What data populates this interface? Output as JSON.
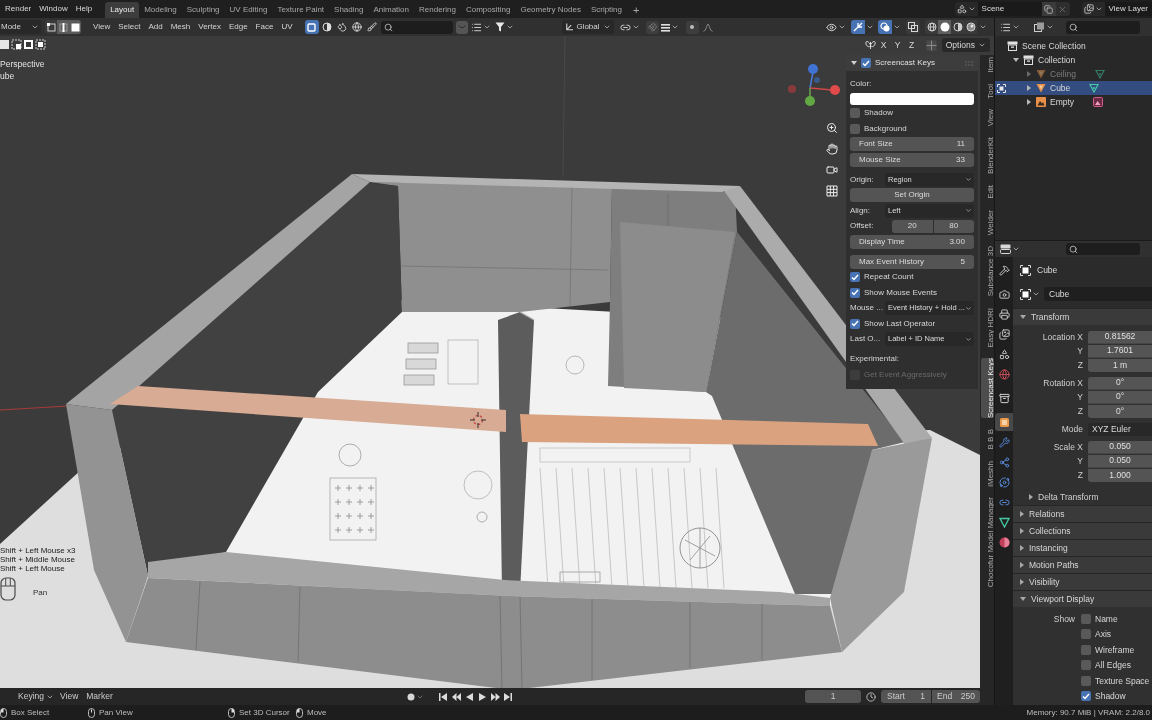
{
  "top_bar": {
    "menus": [
      "Render",
      "Window",
      "Help"
    ],
    "workspaces": [
      {
        "label": "Layout",
        "selected": true
      },
      {
        "label": "Modeling",
        "selected": false
      },
      {
        "label": "Sculpting",
        "selected": false
      },
      {
        "label": "UV Editing",
        "selected": false
      },
      {
        "label": "Texture Paint",
        "selected": false
      },
      {
        "label": "Shading",
        "selected": false
      },
      {
        "label": "Animation",
        "selected": false
      },
      {
        "label": "Rendering",
        "selected": false
      },
      {
        "label": "Compositing",
        "selected": false
      },
      {
        "label": "Geometry Nodes",
        "selected": false
      },
      {
        "label": "Scripting",
        "selected": false
      }
    ],
    "add_tab": "+",
    "scene": "Scene",
    "view_layer": "View Layer"
  },
  "viewport_header": {
    "mode": "Mode",
    "select_modes": [
      {
        "kind": "vertex",
        "selected": false
      },
      {
        "kind": "edge",
        "selected": true
      },
      {
        "kind": "face",
        "selected": true
      }
    ],
    "menus": [
      "View",
      "Select",
      "Add",
      "Mesh",
      "Vertex",
      "Edge",
      "Face",
      "UV"
    ],
    "toggles": [
      {
        "kind": "square",
        "on": true
      },
      {
        "kind": "half_sphere",
        "on": false
      },
      {
        "kind": "droplets",
        "on": false
      },
      {
        "kind": "globe",
        "on": false
      },
      {
        "kind": "brush",
        "on": false
      }
    ],
    "orientation": "Global",
    "gizmos_on": true,
    "overlays_on": true,
    "xray_on": false,
    "shading": [
      {
        "kind": "wireframe",
        "selected": false
      },
      {
        "kind": "solid",
        "selected": true
      },
      {
        "kind": "material",
        "selected": false
      },
      {
        "kind": "rendered",
        "selected": false
      }
    ],
    "mirror": [
      {
        "label": "X",
        "on": false
      },
      {
        "label": "Y",
        "on": false
      },
      {
        "label": "Z",
        "on": false
      }
    ],
    "options": "Options"
  },
  "viewport": {
    "view_name": "Perspective",
    "object_name": "ube",
    "key_log": [
      "Shift + Left Mouse x3",
      "Shift + Middle Mouse",
      "Shift + Left Mouse"
    ],
    "key_hint": "Pan"
  },
  "sidebar": {
    "panel": {
      "title": "Screencast Keys",
      "expanded": true,
      "enabled": true,
      "sections": [
        {
          "rows": [
            {
              "kind": "label",
              "text": "Color:"
            },
            {
              "kind": "color",
              "color": "#ffffff"
            },
            {
              "kind": "checkbox",
              "label": "Shadow",
              "checked": false,
              "disabled": false
            },
            {
              "kind": "checkbox",
              "label": "Background",
              "checked": false,
              "disabled": false
            },
            {
              "kind": "number",
              "label": "Font Size",
              "value": "11"
            },
            {
              "kind": "number",
              "label": "Mouse Size",
              "value": "33"
            }
          ]
        },
        {
          "rows": [
            {
              "kind": "dropdown",
              "label": "Origin:",
              "value": "Region"
            },
            {
              "kind": "button",
              "label": "Set Origin"
            },
            {
              "kind": "dropdown",
              "label": "Align:",
              "value": "Left"
            },
            {
              "kind": "pair",
              "label": "Offset:",
              "values": [
                "20",
                "80"
              ]
            },
            {
              "kind": "number",
              "label": "Display Time",
              "value": "3.00"
            }
          ]
        },
        {
          "rows": [
            {
              "kind": "number",
              "label": "Max Event History",
              "value": "5"
            },
            {
              "kind": "checkbox",
              "label": "Repeat Count",
              "checked": true,
              "disabled": false
            },
            {
              "kind": "checkbox",
              "label": "Show Mouse Events",
              "checked": true,
              "disabled": false
            },
            {
              "kind": "dropdown",
              "label": "Mouse ...",
              "value": "Event History + Hold ..."
            },
            {
              "kind": "checkbox",
              "label": "Show Last Operator",
              "checked": true,
              "disabled": false
            },
            {
              "kind": "dropdown",
              "label": "Last O...",
              "value": "Label + ID Name"
            }
          ]
        },
        {
          "rows": [
            {
              "kind": "label",
              "text": "Experimental:"
            },
            {
              "kind": "checkbox",
              "label": "Get Event Aggressively",
              "checked": false,
              "disabled": true
            }
          ]
        }
      ]
    },
    "tabs": [
      {
        "label": "Item",
        "selected": false
      },
      {
        "label": "Tool",
        "selected": false
      },
      {
        "label": "View",
        "selected": false
      },
      {
        "label": "BlenderKit",
        "selected": false
      },
      {
        "label": "Edit",
        "selected": false
      },
      {
        "label": "Welder",
        "selected": false
      },
      {
        "label": "Substance 3D",
        "selected": false
      },
      {
        "label": "Easy HDRI",
        "selected": false
      },
      {
        "label": "Screencast Keys",
        "selected": true
      },
      {
        "label": "B B B",
        "selected": false
      },
      {
        "label": "iMeshh",
        "selected": false
      },
      {
        "label": "Chocofur Model Manager",
        "selected": false
      }
    ]
  },
  "outliner": {
    "tree": [
      {
        "label": "Scene Collection",
        "kind": "scene_collection",
        "selected": false,
        "children": [
          {
            "label": "Collection",
            "kind": "collection",
            "expanded": true,
            "selected": false,
            "children": [
              {
                "label": "Ceiling",
                "kind": "mesh",
                "expanded": false,
                "selected": false,
                "hidden": true
              },
              {
                "label": "Cube",
                "kind": "mesh",
                "expanded": false,
                "selected": true,
                "hidden": false
              },
              {
                "label": "Empty",
                "kind": "image_empty",
                "expanded": false,
                "selected": false,
                "hidden": false
              }
            ]
          }
        ]
      }
    ]
  },
  "properties": {
    "tab_groups": [
      {
        "tabs": [
          {
            "kind": "tool",
            "selected": false
          }
        ]
      },
      {
        "tabs": [
          {
            "kind": "render",
            "selected": false
          },
          {
            "kind": "output",
            "selected": false
          },
          {
            "kind": "view_layer",
            "selected": false
          },
          {
            "kind": "scene",
            "selected": false
          },
          {
            "kind": "world",
            "selected": false
          }
        ]
      },
      {
        "tabs": [
          {
            "kind": "collection",
            "selected": false
          }
        ]
      },
      {
        "tabs": [
          {
            "kind": "object",
            "selected": true
          },
          {
            "kind": "modifiers",
            "selected": false
          },
          {
            "kind": "particles",
            "selected": false
          },
          {
            "kind": "physics",
            "selected": false
          },
          {
            "kind": "constraints",
            "selected": false
          },
          {
            "kind": "data",
            "selected": false
          },
          {
            "kind": "material",
            "selected": false
          }
        ]
      }
    ],
    "object_name": "Cube",
    "data_name": "Cube",
    "panels": [
      {
        "title": "Transform",
        "expanded": true,
        "groups": [
          {
            "rows": [
              {
                "kind": "number",
                "label": "Location X",
                "value": "0.81562"
              },
              {
                "kind": "number",
                "label": "Y",
                "value": "1.7601"
              },
              {
                "kind": "number",
                "label": "Z",
                "value": "1 m"
              }
            ]
          },
          {
            "rows": [
              {
                "kind": "number",
                "label": "Rotation X",
                "value": "0°"
              },
              {
                "kind": "number",
                "label": "Y",
                "value": "0°"
              },
              {
                "kind": "number",
                "label": "Z",
                "value": "0°"
              }
            ]
          },
          {
            "rows": [
              {
                "kind": "dropdown",
                "label": "Mode",
                "value": "XYZ Euler"
              }
            ]
          },
          {
            "rows": [
              {
                "kind": "number",
                "label": "Scale X",
                "value": "0.050"
              },
              {
                "kind": "number",
                "label": "Y",
                "value": "0.050"
              },
              {
                "kind": "number",
                "label": "Z",
                "value": "1.000"
              }
            ]
          }
        ],
        "subpanels": [
          {
            "title": "Delta Transform",
            "expanded": false
          }
        ]
      },
      {
        "title": "Relations",
        "expanded": false
      },
      {
        "title": "Collections",
        "expanded": false
      },
      {
        "title": "Instancing",
        "expanded": false
      },
      {
        "title": "Motion Paths",
        "expanded": false
      },
      {
        "title": "Visibility",
        "expanded": false
      },
      {
        "title": "Viewport Display",
        "expanded": true,
        "show_label": "Show",
        "options": [
          {
            "label": "Name",
            "checked": false
          },
          {
            "label": "Axis",
            "checked": false
          },
          {
            "label": "Wireframe",
            "checked": false
          },
          {
            "label": "All Edges",
            "checked": false
          },
          {
            "label": "Texture Space",
            "checked": false
          },
          {
            "label": "Shadow",
            "checked": true
          }
        ]
      }
    ]
  },
  "timeline": {
    "keying": "Keying",
    "menus": [
      "View",
      "Marker"
    ],
    "current_frame": "1",
    "start_label": "Start",
    "start": "1",
    "end_label": "End",
    "end": "250"
  },
  "status_bar": {
    "hints": [
      {
        "kind": "left_click",
        "label": "Box Select"
      },
      {
        "kind": "middle_click",
        "label": "Pan View"
      },
      {
        "kind": "right_click",
        "label": "Set 3D Cursor"
      },
      {
        "kind": "drag",
        "label": "Move"
      }
    ],
    "stats": "Memory: 90.7 MiB | VRAM: 2.2/8.0"
  }
}
